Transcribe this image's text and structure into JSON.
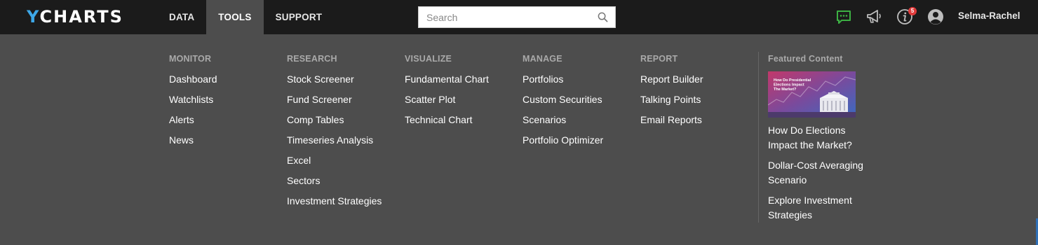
{
  "brand": {
    "logo_y": "Y",
    "logo_rest": "CHARTS"
  },
  "nav": {
    "items": [
      {
        "label": "DATA",
        "active": false
      },
      {
        "label": "TOOLS",
        "active": true
      },
      {
        "label": "SUPPORT",
        "active": false
      }
    ]
  },
  "search": {
    "placeholder": "Search",
    "value": ""
  },
  "header_icons": {
    "chat": "chat-icon",
    "announcements": "megaphone-icon",
    "info": "info-icon",
    "info_badge": "5",
    "account": "user-avatar-icon"
  },
  "user": {
    "name": "Selma-Rachel"
  },
  "menu": {
    "columns": [
      {
        "heading": "MONITOR",
        "links": [
          "Dashboard",
          "Watchlists",
          "Alerts",
          "News"
        ]
      },
      {
        "heading": "RESEARCH",
        "links": [
          "Stock Screener",
          "Fund Screener",
          "Comp Tables",
          "Timeseries Analysis",
          "Excel",
          "Sectors",
          "Investment Strategies"
        ]
      },
      {
        "heading": "VISUALIZE",
        "links": [
          "Fundamental Chart",
          "Scatter Plot",
          "Technical Chart"
        ]
      },
      {
        "heading": "MANAGE",
        "links": [
          "Portfolios",
          "Custom Securities",
          "Scenarios",
          "Portfolio Optimizer"
        ]
      },
      {
        "heading": "REPORT",
        "links": [
          "Report Builder",
          "Talking Points",
          "Email Reports"
        ]
      }
    ]
  },
  "featured": {
    "heading": "Featured Content",
    "image_title": "How Do Presidential Elections Impact The Market?",
    "links": [
      "How Do Elections Impact the Market?",
      "Dollar-Cost Averaging Scenario",
      "Explore Investment Strategies"
    ]
  },
  "colors": {
    "topbar": "#1b1b1b",
    "menu_bg": "#4d4d4d",
    "logo_accent": "#3da8e8",
    "chat_icon": "#3cb043",
    "badge": "#e03a3a"
  }
}
